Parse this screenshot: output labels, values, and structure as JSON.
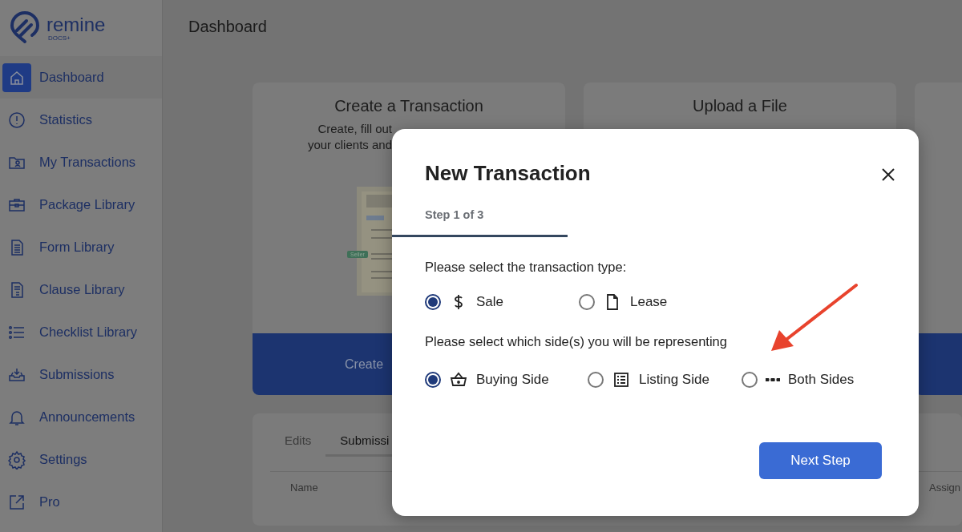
{
  "sidebar": {
    "logo": {
      "name": "remine",
      "sub": "DOCS+"
    },
    "items": [
      {
        "label": "Dashboard",
        "selected": true
      },
      {
        "label": "Statistics",
        "selected": false
      },
      {
        "label": "My Transactions",
        "selected": false
      },
      {
        "label": "Package Library",
        "selected": false
      },
      {
        "label": "Form Library",
        "selected": false
      },
      {
        "label": "Clause Library",
        "selected": false
      },
      {
        "label": "Checklist Library",
        "selected": false
      },
      {
        "label": "Submissions",
        "selected": false
      },
      {
        "label": "Announcements",
        "selected": false
      },
      {
        "label": "Settings",
        "selected": false
      },
      {
        "label": "Pro",
        "selected": false
      }
    ]
  },
  "page_title": "Dashboard",
  "cards": [
    {
      "title": "Create a Transaction",
      "description": [
        "Create, fill out",
        "your clients and"
      ],
      "tag": "Seller",
      "button": "Create"
    },
    {
      "title": "Upload a File"
    },
    {
      "kind": "action"
    }
  ],
  "bottom_panel": {
    "tabs": [
      {
        "label": "Edits",
        "selected": false
      },
      {
        "label": "Submissi",
        "selected": true
      }
    ],
    "columns": [
      "Name",
      "Assign"
    ]
  },
  "modal": {
    "title": "New Transaction",
    "step": "Step 1 of 3",
    "level": 0.333,
    "groups": [
      {
        "prompt": "Please select the transaction type:",
        "options": [
          {
            "label": "Sale",
            "selected": true
          },
          {
            "label": "Lease",
            "selected": false
          }
        ]
      },
      {
        "prompt": "Please select which side(s) you will be representing",
        "options": [
          {
            "label": "Buying Side",
            "selected": true
          },
          {
            "label": "Listing Side",
            "selected": false
          },
          {
            "label": "Both Sides",
            "selected": false
          }
        ]
      }
    ],
    "button": "Next Step"
  }
}
